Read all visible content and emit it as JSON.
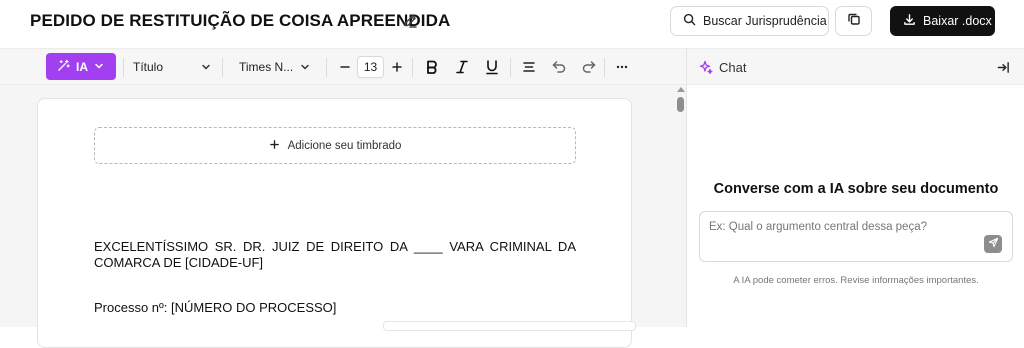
{
  "header": {
    "title": "PEDIDO DE RESTITUIÇÃO DE COISA APREENDIDA",
    "search_juris_label": "Buscar Jurisprudência",
    "download_label": "Baixar .docx"
  },
  "toolbar": {
    "ia_label": "IA",
    "style_select": "Título",
    "font_select": "Times N...",
    "font_size": "13",
    "accent_color": "#a23ff0"
  },
  "chat": {
    "title": "Chat",
    "heading": "Converse com a IA sobre seu documento",
    "input_placeholder": "Ex: Qual o argumento central dessa peça?",
    "disclaimer": "A IA pode cometer erros. Revise informações importantes."
  },
  "document": {
    "letterhead_label": "Adicione seu timbrado",
    "paragraphs": [
      "EXCELENTÍSSIMO SR. DR. JUIZ DE DIREITO DA ____ VARA CRIMINAL DA COMARCA DE [CIDADE-UF]",
      "Processo nº: [NÚMERO DO PROCESSO]"
    ]
  },
  "icons": [
    "edit-icon",
    "search-icon",
    "copy-icon",
    "download-icon",
    "magic-wand-icon",
    "chevron-down-icon",
    "minus-icon",
    "plus-icon",
    "bold-icon",
    "italic-icon",
    "underline-icon",
    "align-icon",
    "undo-icon",
    "redo-icon",
    "more-icon",
    "sparkle-icon",
    "collapse-panel-icon",
    "send-icon"
  ]
}
